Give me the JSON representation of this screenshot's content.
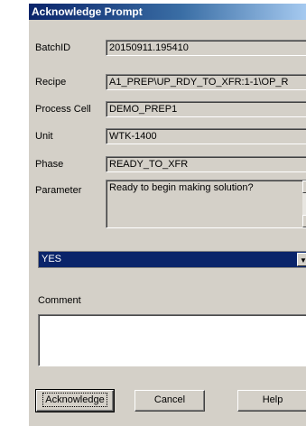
{
  "window": {
    "title": "Acknowledge Prompt"
  },
  "fields": [
    {
      "label": "BatchID",
      "value": "20150911.195410"
    },
    {
      "label": "Recipe",
      "value": "A1_PREP\\UP_RDY_TO_XFR:1-1\\OP_R"
    },
    {
      "label": "Process Cell",
      "value": "DEMO_PREP1"
    },
    {
      "label": "Unit",
      "value": "WTK-1400"
    },
    {
      "label": "Phase",
      "value": "READY_TO_XFR"
    }
  ],
  "parameter": {
    "label": "Parameter",
    "value": "Ready to begin making solution?"
  },
  "response": {
    "selected": "YES"
  },
  "comment": {
    "label": "Comment",
    "value": ""
  },
  "buttons": {
    "acknowledge": "Acknowledge",
    "cancel": "Cancel",
    "help": "Help"
  },
  "colors": {
    "titlebar": "#0a246a",
    "face": "#d4d0c8",
    "selection": "#0a246a"
  },
  "icons": {
    "scroll_up": "triangle-up-icon",
    "scroll_down": "triangle-down-icon",
    "dropdown": "triangle-down-icon"
  }
}
